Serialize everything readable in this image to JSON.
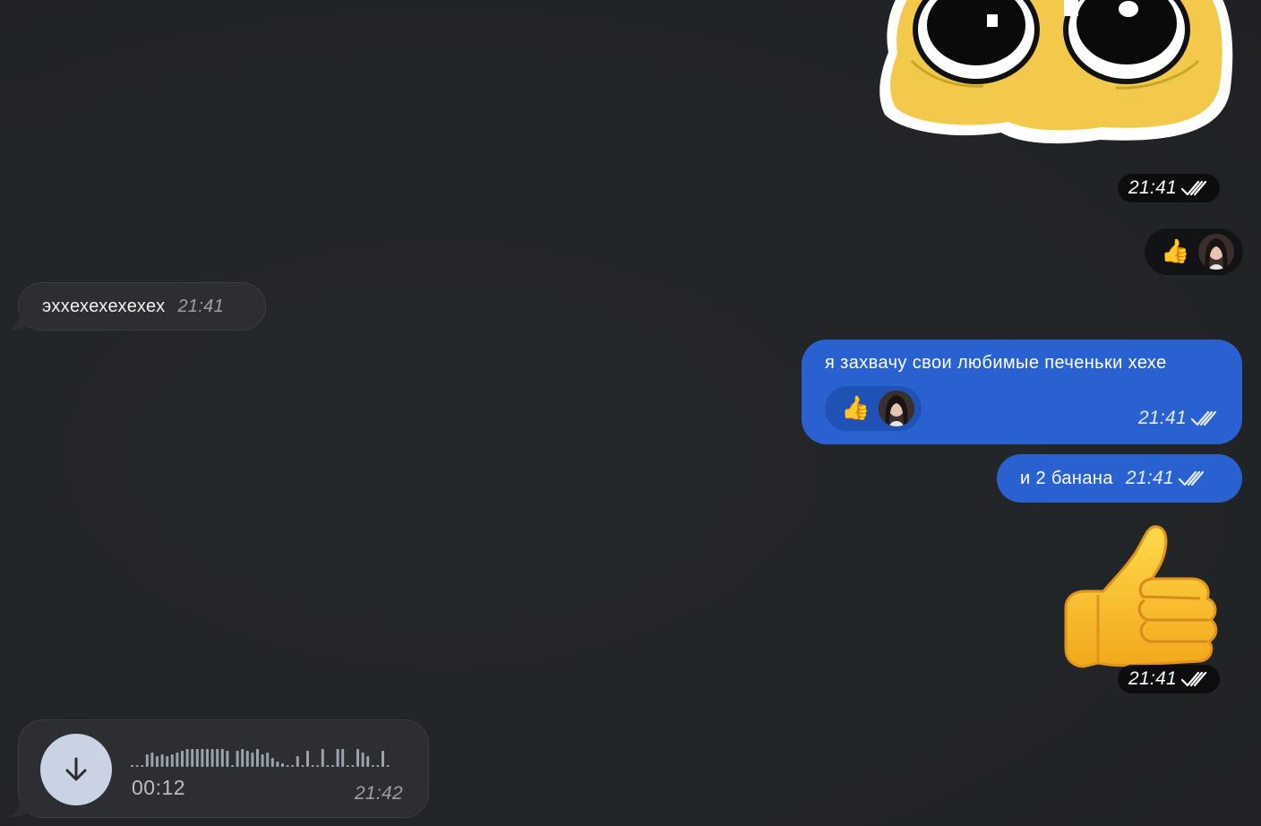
{
  "messages": {
    "sticker_top": {
      "time": "21:41",
      "icon": "cute-emoji-sticker"
    },
    "reaction_row": {
      "emoji": "👍",
      "avatar": "user-avatar"
    },
    "incoming_text": {
      "text": "эххехехехехех",
      "time": "21:41"
    },
    "outgoing_cookies": {
      "text": "я захвачу свои любимые печеньки хехе",
      "reaction_emoji": "👍",
      "time": "21:41"
    },
    "outgoing_bananas": {
      "text": "и 2 банана",
      "time": "21:41"
    },
    "thumb_sticker": {
      "time": "21:41",
      "icon": "thumbs-up-sticker"
    },
    "voice_message": {
      "duration": "00:12",
      "time": "21:42",
      "waveform": [
        2,
        2,
        2,
        14,
        16,
        12,
        14,
        12,
        14,
        16,
        18,
        20,
        20,
        20,
        20,
        20,
        20,
        20,
        20,
        18,
        2,
        18,
        20,
        18,
        16,
        20,
        14,
        16,
        10,
        6,
        4,
        2,
        2,
        12,
        2,
        18,
        2,
        2,
        20,
        2,
        2,
        20,
        20,
        2,
        2,
        20,
        16,
        12,
        2,
        2,
        18,
        2
      ]
    }
  },
  "colors": {
    "background": "#232629",
    "outgoing": "#2a61d0",
    "incoming": "#2c2e31",
    "voice_button": "#c9d3e3"
  }
}
